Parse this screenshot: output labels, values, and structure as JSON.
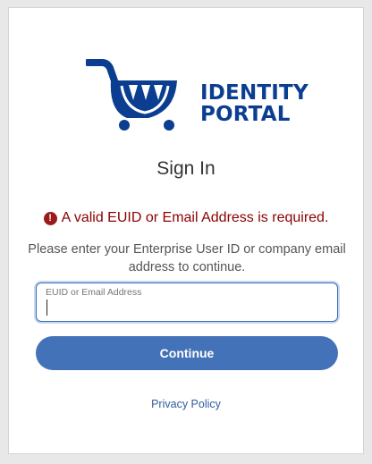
{
  "logo": {
    "line1": "IDENTITY",
    "line2": "PORTAL",
    "brand_color": "#0b3d91",
    "accent_color": "#ffffff"
  },
  "title": "Sign In",
  "error": {
    "icon": "exclamation-circle-icon",
    "message": "A valid EUID or Email Address is required.",
    "color": "#8b0000"
  },
  "description": "Please enter your Enterprise User ID or company email address to continue.",
  "login_field": {
    "label": "EUID or Email Address",
    "value": ""
  },
  "continue_button": {
    "label": "Continue",
    "color": "#4472b8"
  },
  "privacy_link": "Privacy Policy"
}
